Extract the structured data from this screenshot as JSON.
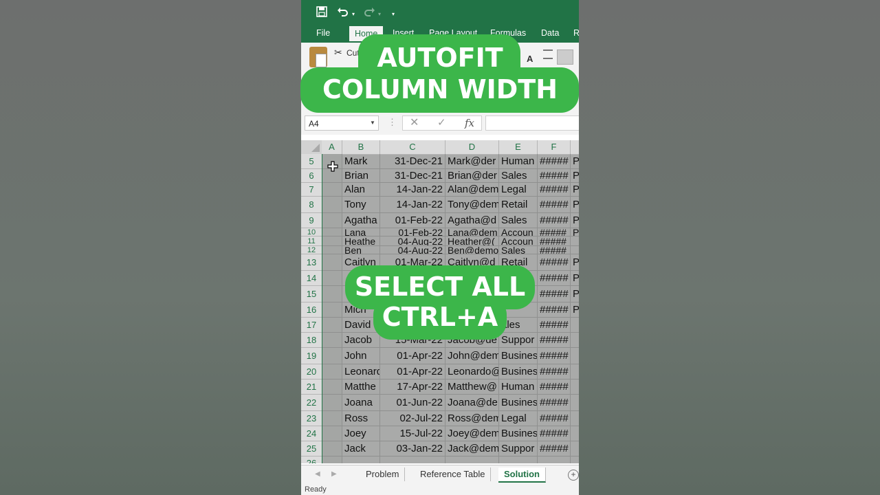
{
  "quick_access": {
    "save_icon": "save-icon",
    "undo_icon": "undo-icon",
    "redo_icon": "redo-icon",
    "customize_icon": "customize-icon"
  },
  "ribbon_tabs": [
    "File",
    "Home",
    "Insert",
    "Page Layout",
    "Formulas",
    "Data",
    "R"
  ],
  "ribbon": {
    "cut_label": "Cut",
    "font_button": "A"
  },
  "formula_bar": {
    "name_box": "A4",
    "fx_label": "fx",
    "cancel_glyph": "✕",
    "enter_glyph": "✓",
    "dots": "⋮",
    "value": ""
  },
  "columns": [
    "A",
    "B",
    "C",
    "D",
    "E",
    "F"
  ],
  "rows": [
    {
      "num": "5",
      "b": "Mark",
      "c": "31-Dec-21",
      "d": "Mark@der",
      "e": "Human",
      "f": "#####",
      "g": "Pe"
    },
    {
      "num": "6",
      "b": "Brian",
      "c": "31-Dec-21",
      "d": "Brian@der",
      "e": "Sales",
      "f": "#####",
      "g": "Pe"
    },
    {
      "num": "7",
      "b": "Alan",
      "c": "14-Jan-22",
      "d": "Alan@dem",
      "e": "Legal",
      "f": "#####",
      "g": "Pe"
    },
    {
      "num": "8",
      "b": "Tony",
      "c": "14-Jan-22",
      "d": "Tony@dem",
      "e": "Retail",
      "f": "#####",
      "g": "Pe"
    },
    {
      "num": "9",
      "b": "Agatha",
      "c": "01-Feb-22",
      "d": "Agatha@d",
      "e": "Sales",
      "f": "#####",
      "g": "Pe"
    },
    {
      "num": "10",
      "b": "Lana",
      "c": "01-Feb-22",
      "d": "Lana@dem",
      "e": "Accoun",
      "f": "#####",
      "g": "Pe"
    },
    {
      "num": "11",
      "b": "Heathe",
      "c": "04-Aug-22",
      "d": "Heather@(",
      "e": "Accoun",
      "f": "#####",
      "g": ""
    },
    {
      "num": "12",
      "b": "Ben",
      "c": "04-Aug-22",
      "d": "Ben@demo",
      "e": "Sales",
      "f": "#####",
      "g": ""
    },
    {
      "num": "13",
      "b": "Caitlyn",
      "c": "01-Mar-22",
      "d": "Caitlyn@d",
      "e": "Retail",
      "f": "#####",
      "g": "Pe"
    },
    {
      "num": "14",
      "b": "",
      "c": "",
      "d": "",
      "e": "",
      "f": "#####",
      "g": "Pe"
    },
    {
      "num": "15",
      "b": "",
      "c": "",
      "d": "",
      "e": "",
      "f": "#####",
      "g": "Pe"
    },
    {
      "num": "16",
      "b": "Mich",
      "c": "",
      "d": "",
      "e": "",
      "f": "#####",
      "g": "Pe"
    },
    {
      "num": "17",
      "b": "David",
      "c": "",
      "d": "",
      "e": "ales",
      "f": "#####",
      "g": ""
    },
    {
      "num": "18",
      "b": "Jacob",
      "c": "15-Mar-22",
      "d": "Jacob@de",
      "e": "Suppor",
      "f": "#####",
      "g": ""
    },
    {
      "num": "19",
      "b": "John",
      "c": "01-Apr-22",
      "d": "John@dem",
      "e": "Busines",
      "f": "#####",
      "g": ""
    },
    {
      "num": "20",
      "b": "Leonard",
      "c": "01-Apr-22",
      "d": "Leonardo@",
      "e": "Busines",
      "f": "#####",
      "g": ""
    },
    {
      "num": "21",
      "b": "Matthe",
      "c": "17-Apr-22",
      "d": "Matthew@",
      "e": "Human",
      "f": "#####",
      "g": ""
    },
    {
      "num": "22",
      "b": "Joana",
      "c": "01-Jun-22",
      "d": "Joana@de",
      "e": "Busines",
      "f": "#####",
      "g": ""
    },
    {
      "num": "23",
      "b": "Ross",
      "c": "02-Jul-22",
      "d": "Ross@dem",
      "e": "Legal",
      "f": "#####",
      "g": ""
    },
    {
      "num": "24",
      "b": "Joey",
      "c": "15-Jul-22",
      "d": "Joey@dem",
      "e": "Busines",
      "f": "#####",
      "g": ""
    },
    {
      "num": "25",
      "b": "Jack",
      "c": "03-Jan-22",
      "d": "Jack@dem",
      "e": "Suppor",
      "f": "#####",
      "g": ""
    },
    {
      "num": "26",
      "b": "",
      "c": "",
      "d": "",
      "e": "",
      "f": "",
      "g": ""
    }
  ],
  "sheet_tabs": [
    "Problem",
    "Reference Table",
    "Solution"
  ],
  "active_sheet": "Solution",
  "status": "Ready",
  "overlay": {
    "line1": "AUTOFIT",
    "line2": "COLUMN WIDTH",
    "line3": "SELECT ALL",
    "line4": "CTRL+A"
  },
  "colors": {
    "excel_green": "#217346",
    "overlay_green": "#3cb64a"
  }
}
